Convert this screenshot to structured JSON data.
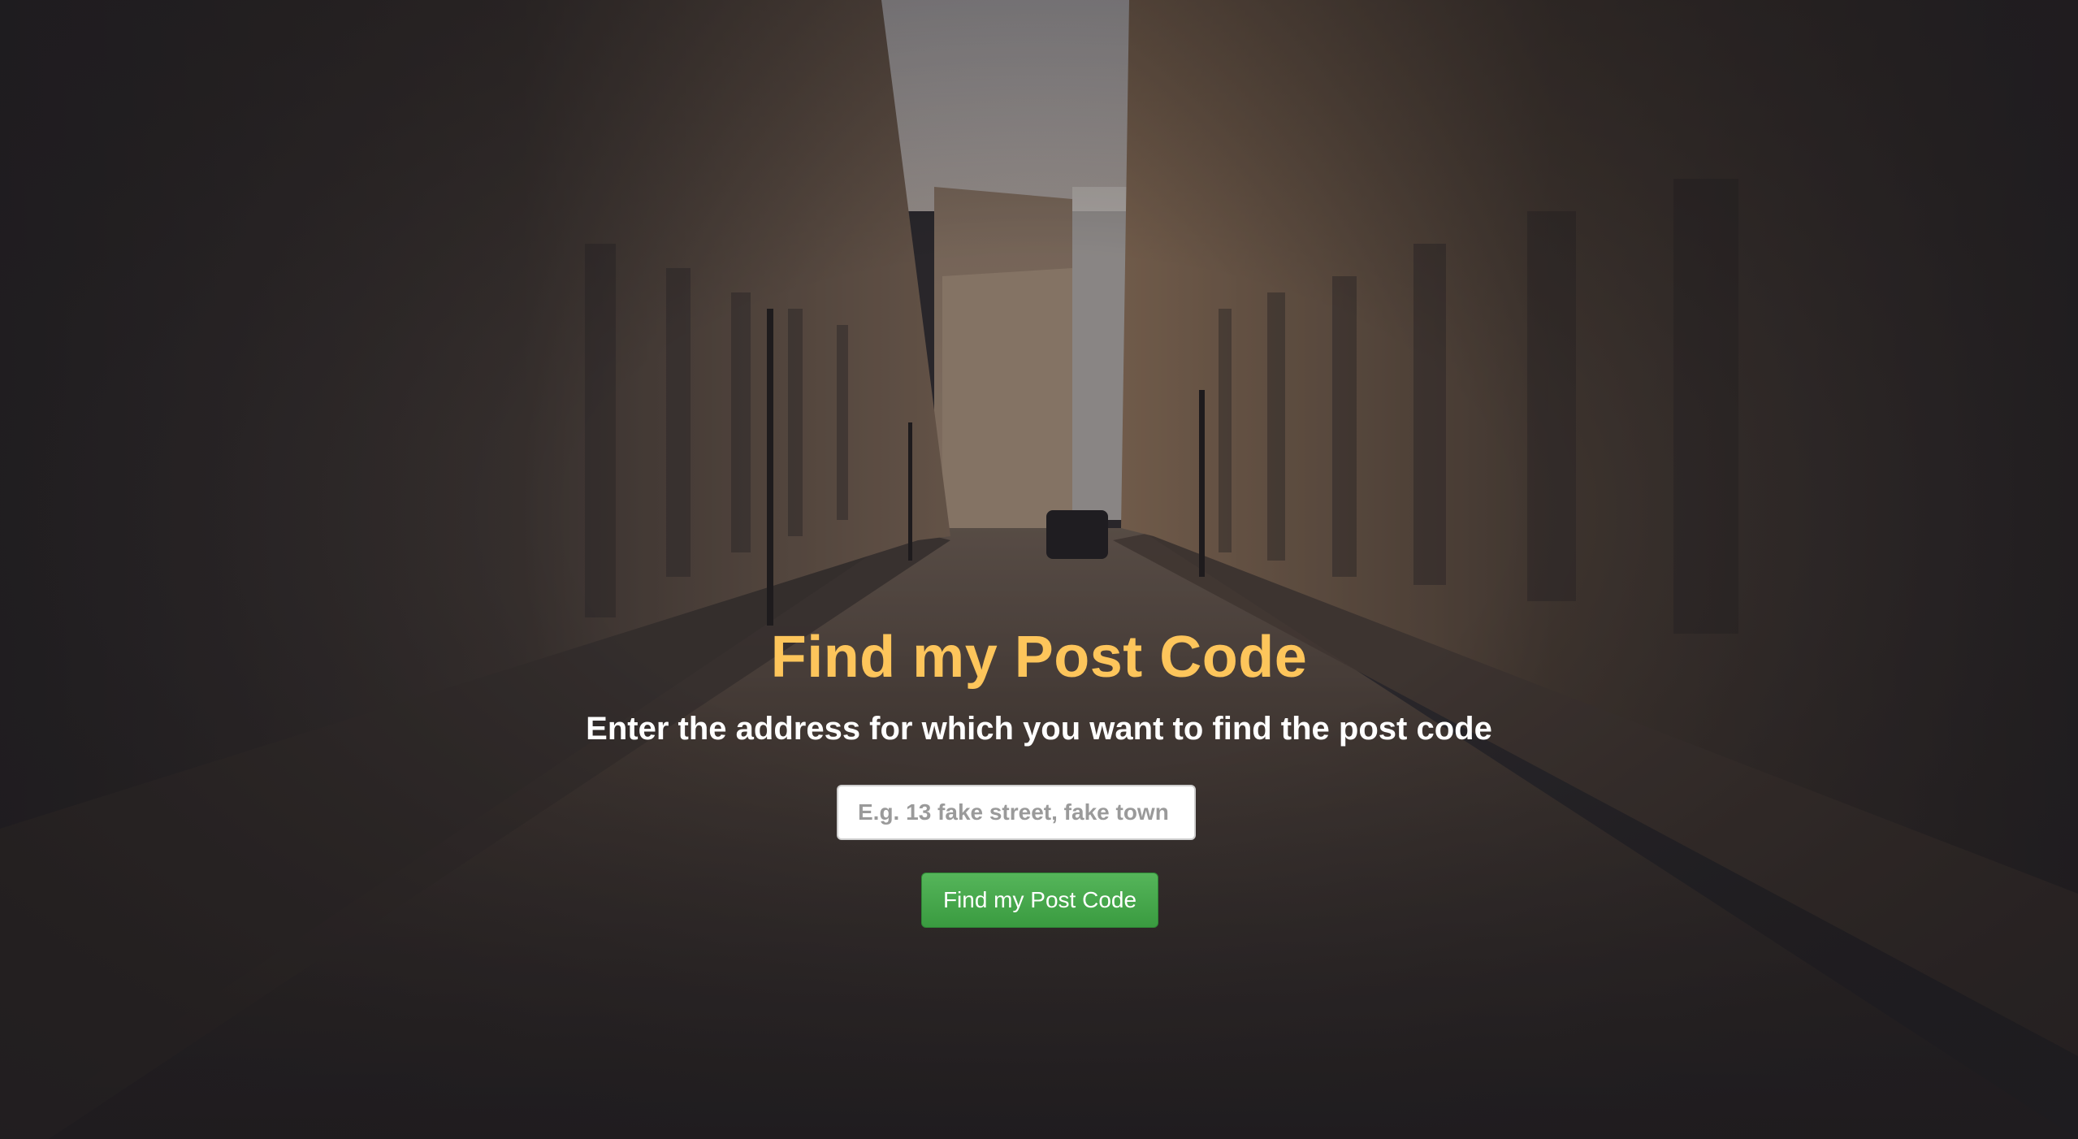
{
  "page": {
    "title": "Find my Post Code",
    "subtitle": "Enter the address for which you want to find the post code"
  },
  "search": {
    "placeholder": "E.g. 13 fake street, fake town",
    "value": ""
  },
  "actions": {
    "submit_label": "Find my Post Code"
  },
  "colors": {
    "title": "#fdc55b",
    "subtitle": "#ffffff",
    "button": "#45a84b",
    "overlay": "#2c2a2e"
  },
  "background": {
    "icon": "city-street-photo"
  }
}
